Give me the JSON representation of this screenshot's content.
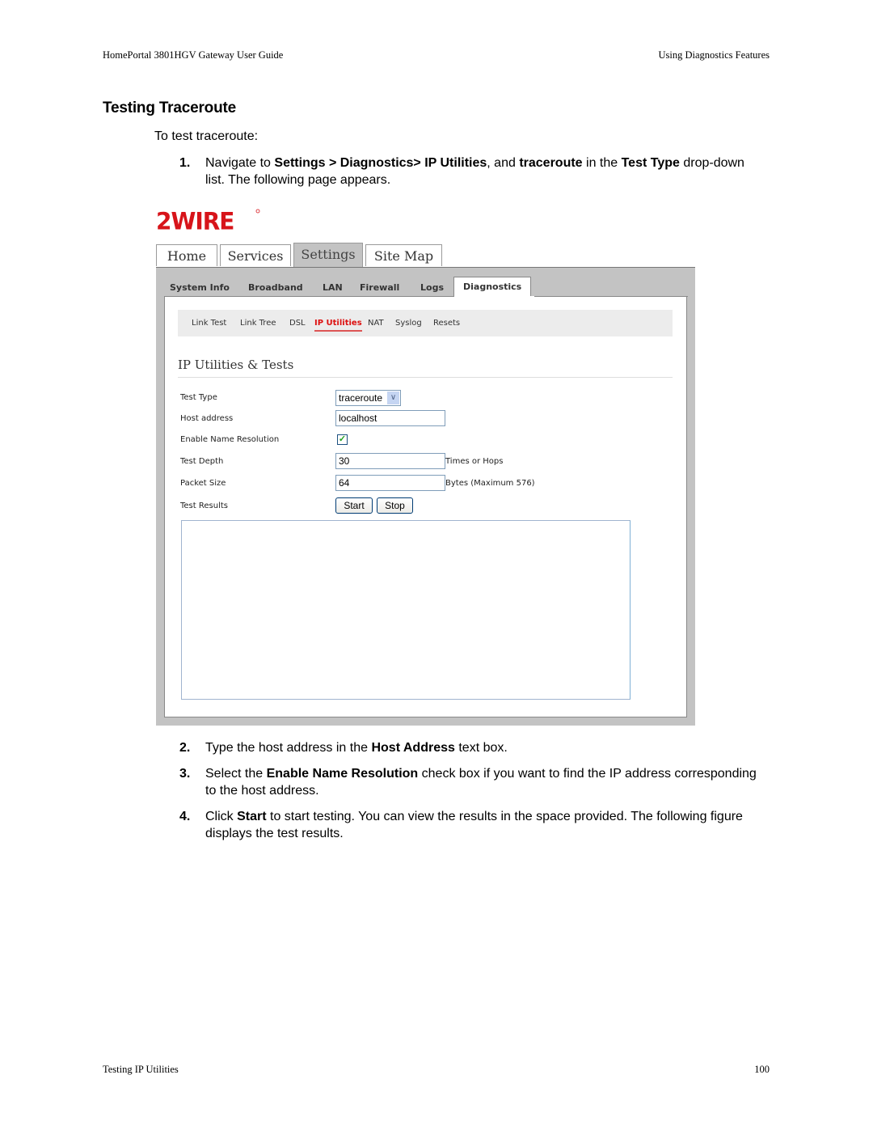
{
  "header": {
    "left": "HomePortal 3801HGV Gateway User Guide",
    "right": "Using Diagnostics Features"
  },
  "section_title": "Testing Traceroute",
  "intro": "To test traceroute:",
  "steps": [
    {
      "num": "1.",
      "parts": [
        {
          "t": "Navigate to ",
          "b": false
        },
        {
          "t": "Settings > Diagnostics> IP Utilities",
          "b": true
        },
        {
          "t": ", and ",
          "b": false
        },
        {
          "t": "traceroute",
          "b": true
        },
        {
          "t": " in the ",
          "b": false
        },
        {
          "t": "Test Type",
          "b": true
        },
        {
          "t": " drop-down list. The following page appears.",
          "b": false
        }
      ]
    },
    {
      "num": "2.",
      "parts": [
        {
          "t": "Type the host address in the ",
          "b": false
        },
        {
          "t": "Host Address",
          "b": true
        },
        {
          "t": " text box.",
          "b": false
        }
      ]
    },
    {
      "num": "3.",
      "parts": [
        {
          "t": "Select the ",
          "b": false
        },
        {
          "t": "Enable Name Resolution",
          "b": true
        },
        {
          "t": " check box if you want to find the IP address corresponding to the host address.",
          "b": false
        }
      ]
    },
    {
      "num": "4.",
      "parts": [
        {
          "t": "Click ",
          "b": false
        },
        {
          "t": "Start",
          "b": true
        },
        {
          "t": " to start testing. You can view the results in the space provided. The following figure displays the test results.",
          "b": false
        }
      ]
    }
  ],
  "figure": {
    "logo_text": "2WIRE",
    "brand_color": "#d7141a",
    "main_tabs": [
      {
        "label": "Home",
        "active": false
      },
      {
        "label": "Services",
        "active": false
      },
      {
        "label": "Settings",
        "active": true
      },
      {
        "label": "Site Map",
        "active": false
      }
    ],
    "sub_tabs": [
      {
        "label": "System Info",
        "active": false
      },
      {
        "label": "Broadband",
        "active": false
      },
      {
        "label": "LAN",
        "active": false
      },
      {
        "label": "Firewall",
        "active": false
      },
      {
        "label": "Logs",
        "active": false
      },
      {
        "label": "Diagnostics",
        "active": true
      }
    ],
    "tools": [
      {
        "label": "Link Test",
        "active": false
      },
      {
        "label": "Link Tree",
        "active": false
      },
      {
        "label": "DSL",
        "active": false
      },
      {
        "label": "IP Utilities",
        "active": true
      },
      {
        "label": "NAT",
        "active": false
      },
      {
        "label": "Syslog",
        "active": false
      },
      {
        "label": "Resets",
        "active": false
      }
    ],
    "section_heading": "IP Utilities & Tests",
    "form": {
      "test_type_label": "Test Type",
      "test_type_value": "traceroute",
      "host_label": "Host address",
      "host_value": "localhost",
      "name_res_label": "Enable Name Resolution",
      "name_res_checked": true,
      "depth_label": "Test Depth",
      "depth_value": "30",
      "depth_unit": "Times or Hops",
      "packet_label": "Packet Size",
      "packet_value": "64",
      "packet_unit": "Bytes (Maximum 576)",
      "results_label": "Test Results",
      "start_label": "Start",
      "stop_label": "Stop",
      "results_text": ""
    }
  },
  "footer": {
    "left": "Testing IP Utilities",
    "right": "100"
  }
}
